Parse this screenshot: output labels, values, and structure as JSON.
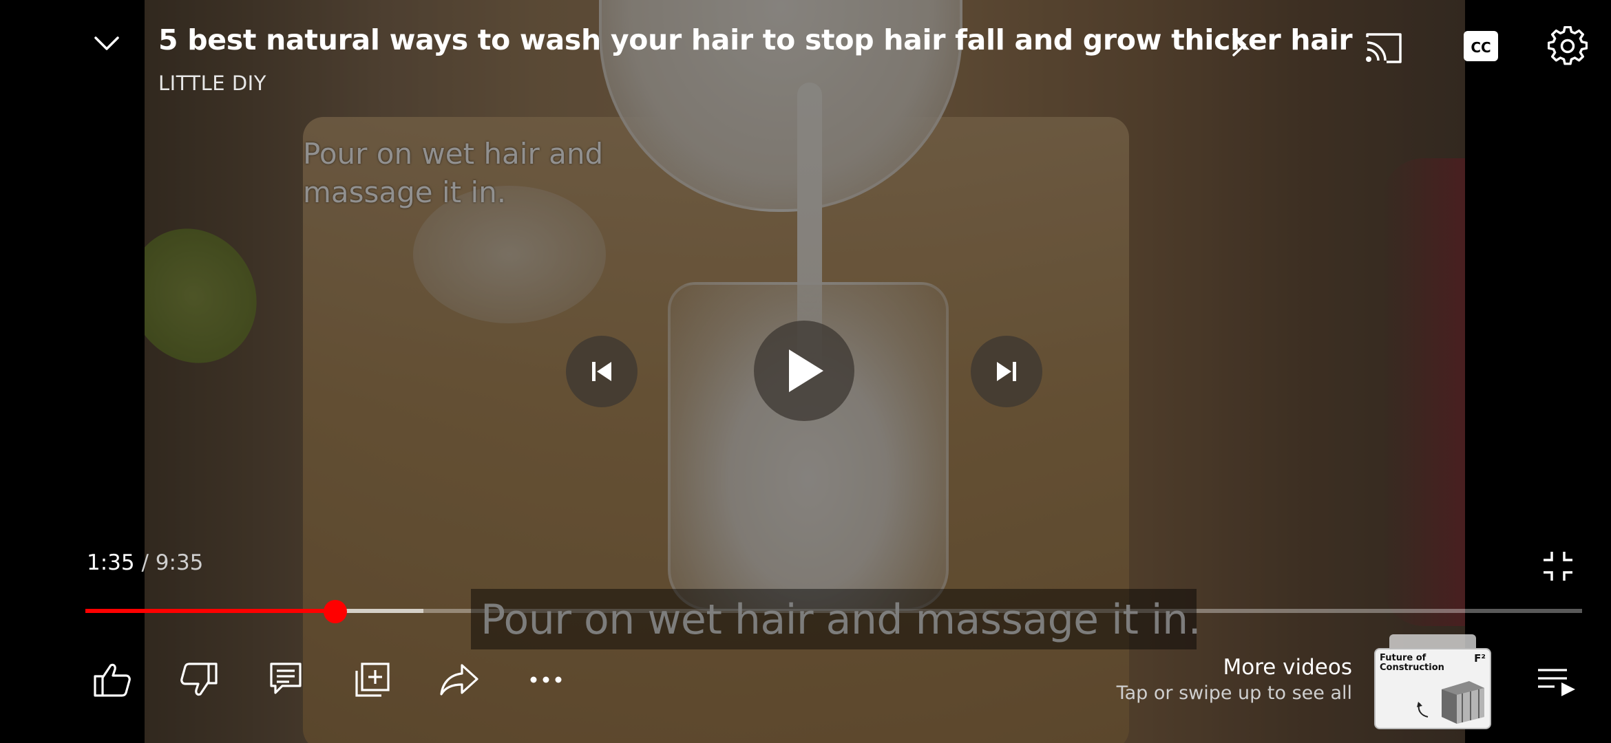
{
  "video": {
    "title": "5 best natural ways to wash your hair to stop hair fall and grow thicker hair",
    "channel": "LITTLE DIY",
    "caption_upper": "Pour on wet hair and massage it in.",
    "caption_lower": "Pour on wet hair and massage it in."
  },
  "playback": {
    "current_time": "1:35",
    "separator": " / ",
    "duration": "9:35",
    "progress_fraction": 0.167,
    "buffered_fraction": 0.226,
    "accent_color": "#ff0000"
  },
  "top_controls": {
    "collapse_icon": "chevron-down-icon",
    "title_more_icon": "chevron-right-icon",
    "cast_icon": "cast-icon",
    "cc_icon": "closed-captions-icon",
    "settings_icon": "gear-icon"
  },
  "center_controls": {
    "previous_icon": "skip-previous-icon",
    "play_icon": "play-icon",
    "next_icon": "skip-next-icon"
  },
  "actions": [
    {
      "name": "like",
      "icon": "thumbs-up-icon"
    },
    {
      "name": "dislike",
      "icon": "thumbs-down-icon"
    },
    {
      "name": "comments",
      "icon": "comment-icon"
    },
    {
      "name": "save",
      "icon": "add-to-playlist-icon"
    },
    {
      "name": "share",
      "icon": "share-icon"
    },
    {
      "name": "more",
      "icon": "more-horizontal-icon"
    }
  ],
  "more_videos": {
    "title": "More videos",
    "subtitle": "Tap or swipe up to see all",
    "thumbnail_text": "Future of Construction",
    "thumbnail_logo": "F²"
  },
  "exit_fullscreen_icon": "exit-fullscreen-icon",
  "queue_icon": "playlist-play-icon"
}
